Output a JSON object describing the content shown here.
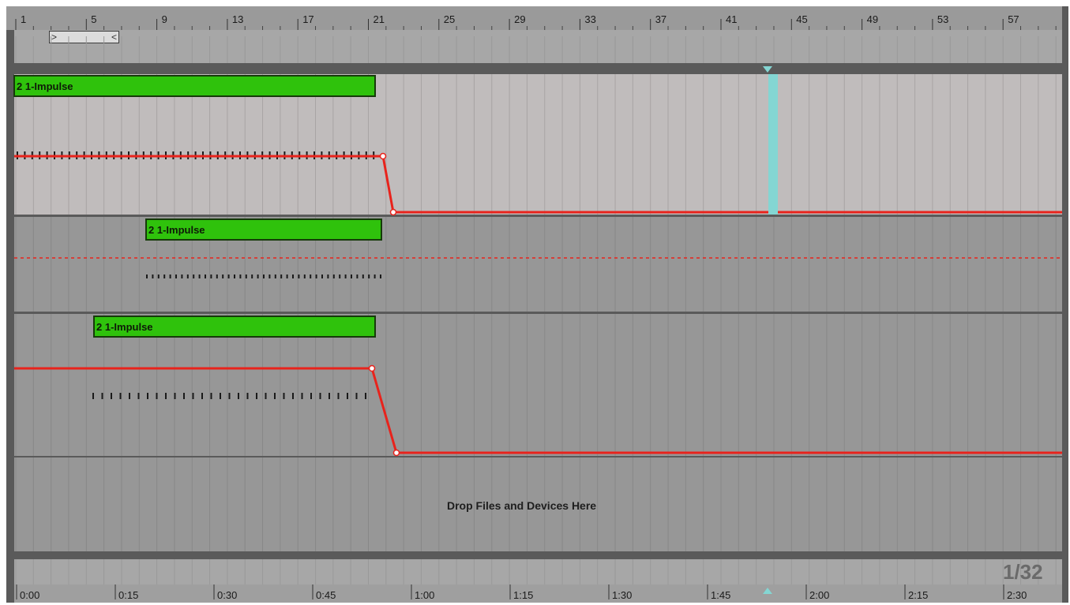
{
  "bar_ruler": {
    "labels": [
      "1",
      "5",
      "9",
      "13",
      "17",
      "21",
      "25",
      "29",
      "33",
      "37",
      "41",
      "45",
      "49",
      "53",
      "57"
    ]
  },
  "time_ruler": {
    "labels": [
      "0:00",
      "0:15",
      "0:30",
      "0:45",
      "1:00",
      "1:15",
      "1:30",
      "1:45",
      "2:00",
      "2:15",
      "2:30"
    ]
  },
  "tracks": [
    {
      "clip_label": "2 1-Impulse"
    },
    {
      "clip_label": "2 1-Impulse"
    },
    {
      "clip_label": "2 1-Impulse"
    }
  ],
  "drop_zone": {
    "text": "Drop Files and Devices Here"
  },
  "zoom": {
    "grid_label": "1/32"
  },
  "colors": {
    "clip": "#2fc20c",
    "automation": "#e8231c",
    "marker": "#84d6d3",
    "lane_light": "#c0bcbc",
    "lane_dark": "#979797"
  },
  "icons": {
    "loop_start": "loop-start-bracket-icon",
    "loop_end": "loop-end-bracket-icon",
    "locator": "locator-marker-icon"
  }
}
